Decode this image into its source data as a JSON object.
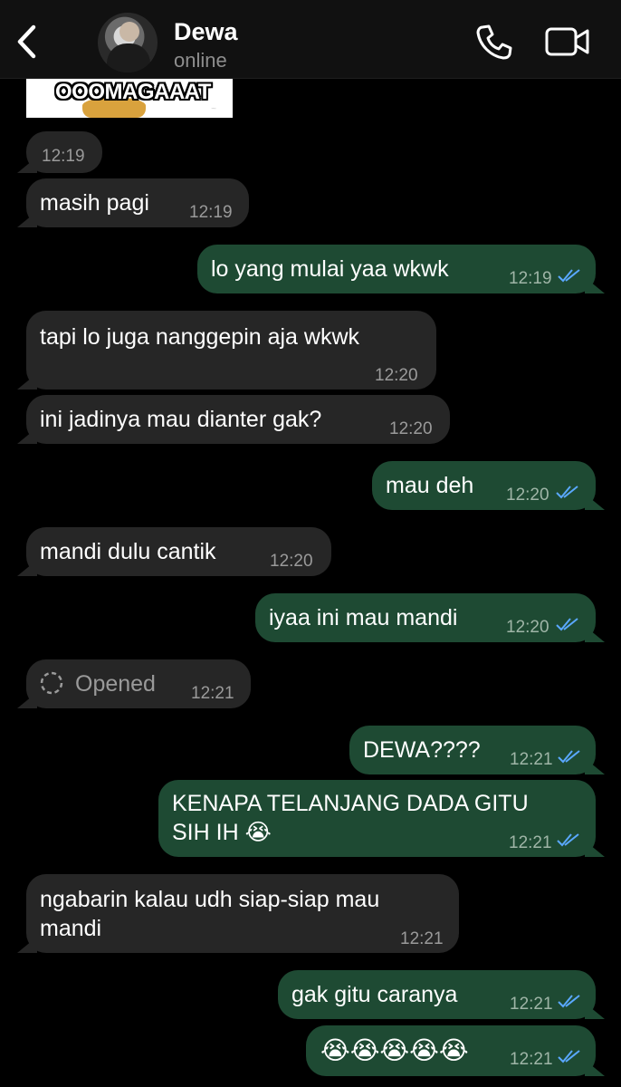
{
  "header": {
    "contact_name": "Dewa",
    "status": "online"
  },
  "sticker": {
    "text": "OOOMAGAAAT"
  },
  "messages": [
    {
      "dir": "in",
      "text": "",
      "time": "12:19"
    },
    {
      "dir": "in",
      "text": "masih pagi",
      "time": "12:19"
    },
    {
      "dir": "out",
      "text": "lo yang mulai yaa wkwk",
      "time": "12:19",
      "read": true
    },
    {
      "dir": "in",
      "text": "tapi lo juga nanggepin aja wkwk",
      "time": "12:20"
    },
    {
      "dir": "in",
      "text": "ini jadinya mau dianter gak?",
      "time": "12:20"
    },
    {
      "dir": "out",
      "text": "mau deh",
      "time": "12:20",
      "read": true
    },
    {
      "dir": "in",
      "text": "mandi dulu cantik",
      "time": "12:20"
    },
    {
      "dir": "out",
      "text": "iyaa ini mau mandi",
      "time": "12:20",
      "read": true
    },
    {
      "dir": "in",
      "text": "Opened",
      "time": "12:21",
      "type": "view-once-opened"
    },
    {
      "dir": "out",
      "text": "DEWA????",
      "time": "12:21",
      "read": true
    },
    {
      "dir": "out",
      "text_line1": "KENAPA TELANJANG DADA GITU",
      "text_line2": "SIH IH 😭",
      "time": "12:21",
      "read": true
    },
    {
      "dir": "in",
      "text_line1": "ngabarin kalau udh siap-siap mau",
      "text_line2": "mandi",
      "time": "12:21"
    },
    {
      "dir": "out",
      "text": "gak gitu caranya",
      "time": "12:21",
      "read": true
    },
    {
      "dir": "out",
      "text": "😭😭😭😭😭",
      "time": "12:21",
      "read": true
    }
  ],
  "colors": {
    "background": "#000000",
    "incoming_bubble": "#262626",
    "outgoing_bubble": "#1e4a33",
    "read_ticks": "#5aa8ff"
  }
}
